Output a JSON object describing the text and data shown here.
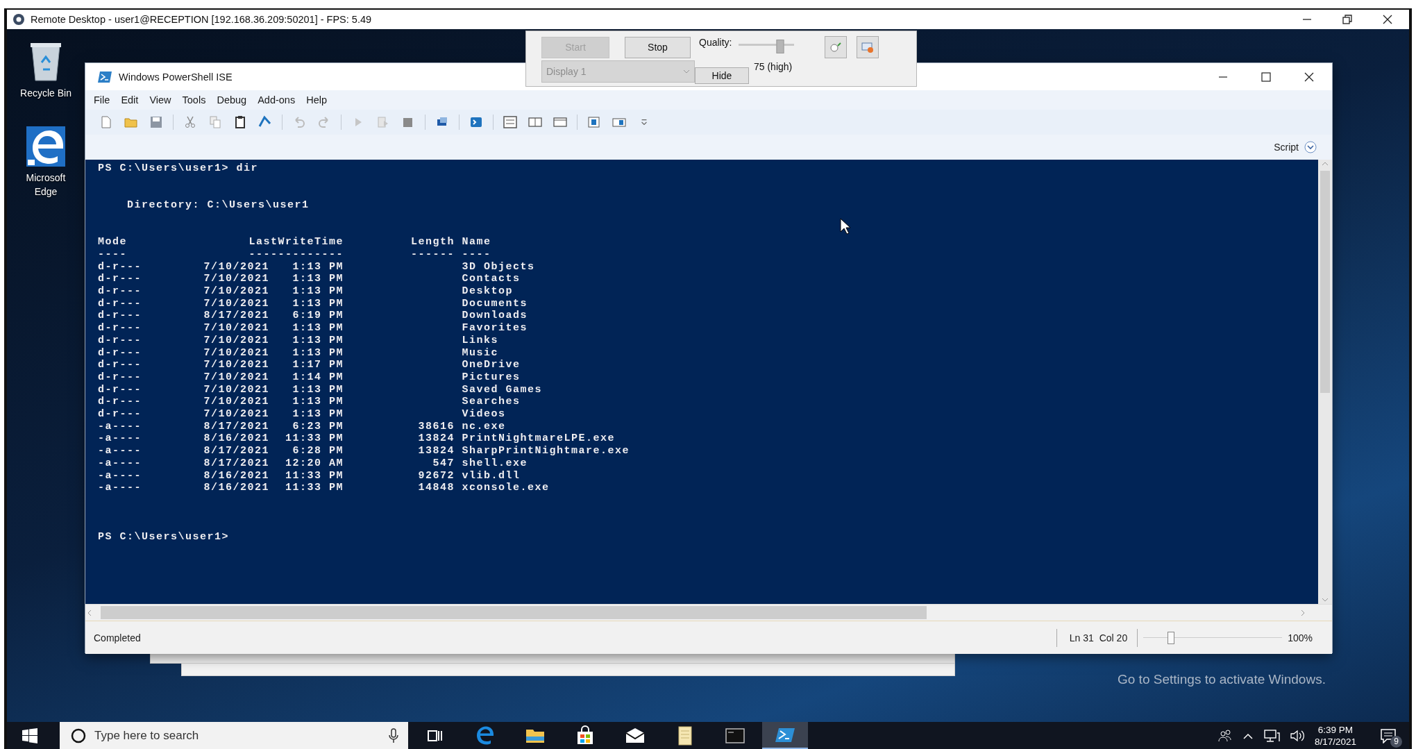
{
  "remote_desktop": {
    "title": "Remote Desktop - user1@RECEPTION [192.168.36.209:50201] - FPS: 5.49"
  },
  "desktop_icons": [
    {
      "kind": "recycle-bin",
      "label": "Recycle Bin"
    },
    {
      "kind": "edge",
      "label": "Microsoft Edge"
    }
  ],
  "capture_panel": {
    "start": {
      "label": "Start",
      "disabled": true
    },
    "stop": {
      "label": "Stop",
      "disabled": false
    },
    "display": {
      "value": "Display 1",
      "disabled": true
    },
    "quality_label": "Quality:",
    "quality": {
      "level": 0.75
    },
    "quality_reading": "75 (high)",
    "hide": {
      "label": "Hide"
    }
  },
  "ise": {
    "title": "Windows PowerShell ISE",
    "menu": [
      "File",
      "Edit",
      "View",
      "Tools",
      "Debug",
      "Add-ons",
      "Help"
    ],
    "script_label": "Script",
    "console": {
      "prompt_command": "PS C:\\Users\\user1> dir",
      "directory": "Directory: C:\\Users\\user1",
      "columns": [
        {
          "header": "Mode",
          "rule": "----"
        },
        {
          "header": "LastWriteTime",
          "rule": "-------------"
        },
        {
          "header": "Length",
          "rule": "------"
        },
        {
          "header": "Name",
          "rule": "----"
        }
      ],
      "rows": [
        {
          "mode": "d-r---",
          "date": "7/10/2021",
          "time": "1:13 PM",
          "name": "3D Objects"
        },
        {
          "mode": "d-r---",
          "date": "7/10/2021",
          "time": "1:13 PM",
          "name": "Contacts"
        },
        {
          "mode": "d-r---",
          "date": "7/10/2021",
          "time": "1:13 PM",
          "name": "Desktop"
        },
        {
          "mode": "d-r---",
          "date": "7/10/2021",
          "time": "1:13 PM",
          "name": "Documents"
        },
        {
          "mode": "d-r---",
          "date": "8/17/2021",
          "time": "6:19 PM",
          "name": "Downloads"
        },
        {
          "mode": "d-r---",
          "date": "7/10/2021",
          "time": "1:13 PM",
          "name": "Favorites"
        },
        {
          "mode": "d-r---",
          "date": "7/10/2021",
          "time": "1:13 PM",
          "name": "Links"
        },
        {
          "mode": "d-r---",
          "date": "7/10/2021",
          "time": "1:13 PM",
          "name": "Music"
        },
        {
          "mode": "d-r---",
          "date": "7/10/2021",
          "time": "1:17 PM",
          "name": "OneDrive"
        },
        {
          "mode": "d-r---",
          "date": "7/10/2021",
          "time": "1:14 PM",
          "name": "Pictures"
        },
        {
          "mode": "d-r---",
          "date": "7/10/2021",
          "time": "1:13 PM",
          "name": "Saved Games"
        },
        {
          "mode": "d-r---",
          "date": "7/10/2021",
          "time": "1:13 PM",
          "name": "Searches"
        },
        {
          "mode": "d-r---",
          "date": "7/10/2021",
          "time": "1:13 PM",
          "name": "Videos"
        },
        {
          "mode": "-a----",
          "date": "8/17/2021",
          "time": "6:23 PM",
          "length": "38616",
          "name": "nc.exe"
        },
        {
          "mode": "-a----",
          "date": "8/16/2021",
          "time": "11:33 PM",
          "length": "13824",
          "name": "PrintNightmareLPE.exe"
        },
        {
          "mode": "-a----",
          "date": "8/17/2021",
          "time": "6:28 PM",
          "length": "13824",
          "name": "SharpPrintNightmare.exe"
        },
        {
          "mode": "-a----",
          "date": "8/17/2021",
          "time": "12:20 AM",
          "length": "547",
          "name": "shell.exe"
        },
        {
          "mode": "-a----",
          "date": "8/16/2021",
          "time": "11:33 PM",
          "length": "92672",
          "name": "vlib.dll"
        },
        {
          "mode": "-a----",
          "date": "8/16/2021",
          "time": "11:33 PM",
          "length": "14848",
          "name": "xconsole.exe"
        }
      ],
      "final_prompt": "PS C:\\Users\\user1>"
    },
    "status": "Completed",
    "line": "Ln 31",
    "column": "Col 20",
    "zoom": {
      "level": 0.2
    },
    "zoom_reading": "100%"
  },
  "activation_notice": "Go to Settings to activate Windows.",
  "taskbar": {
    "search": {
      "placeholder": "Type here to search"
    },
    "apps": [
      {
        "kind": "edge",
        "selected": false
      },
      {
        "kind": "folder",
        "selected": false
      },
      {
        "kind": "store",
        "selected": false
      },
      {
        "kind": "mail",
        "selected": false
      },
      {
        "kind": "notes",
        "selected": false
      },
      {
        "kind": "terminal",
        "selected": false
      },
      {
        "kind": "powershell",
        "selected": true
      }
    ],
    "time": "6:39 PM",
    "date": "8/17/2021",
    "notification_count": "9"
  }
}
